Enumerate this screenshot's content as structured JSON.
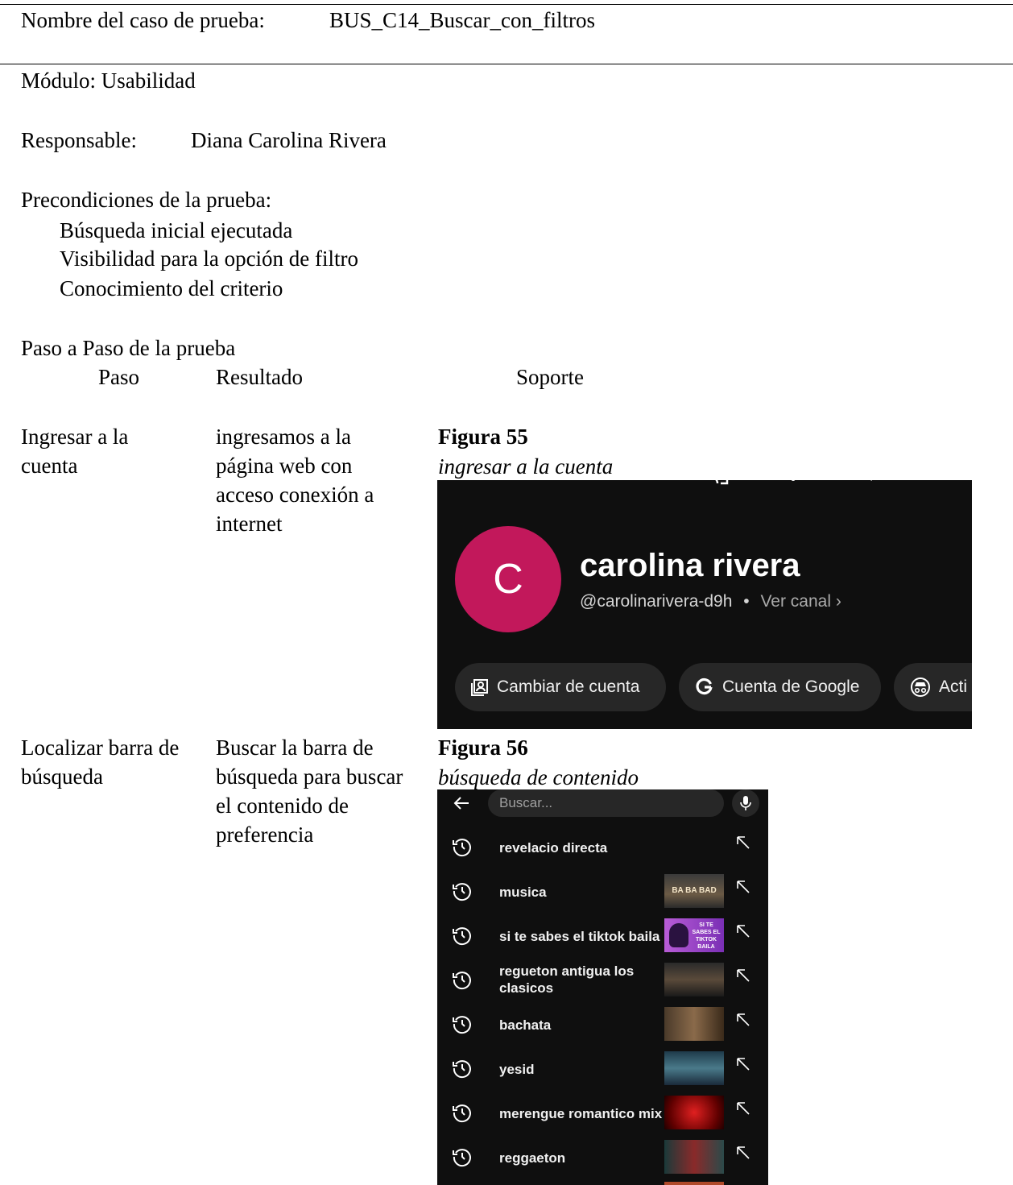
{
  "test_case": {
    "name_label": "Nombre del caso de prueba:",
    "name_value": "BUS_C14_Buscar_con_filtros",
    "module": "Módulo: Usabilidad",
    "responsible_label": "Responsable:",
    "responsible_value": "Diana Carolina Rivera",
    "preconditions_title": "Precondiciones de la prueba:",
    "preconditions": [
      "Búsqueda inicial ejecutada",
      "Visibilidad para la opción de filtro",
      "Conocimiento del criterio"
    ],
    "steps_title": "Paso a Paso de la prueba",
    "columns": [
      "Paso",
      "Resultado",
      "Soporte"
    ]
  },
  "steps": [
    {
      "step": "Ingresar a la cuenta",
      "result": "ingresamos a la página web con acceso conexión a internet",
      "figure_label": "Figura 55",
      "figure_caption": "ingresar a la cuenta"
    },
    {
      "step": "Localizar barra de búsqueda",
      "result": "Buscar la barra de búsqueda para buscar el contenido de preferencia",
      "figure_label": "Figura 56",
      "figure_caption": "búsqueda de contenido"
    }
  ],
  "account_screen": {
    "avatar_letter": "C",
    "name": "carolina rivera",
    "handle": "@carolinarivera-d9h",
    "separator": "•",
    "view_channel": "Ver canal",
    "chips": [
      "Cambiar de cuenta",
      "Cuenta de Google",
      "Acti"
    ],
    "colors": {
      "background": "#0f0f0f",
      "avatar": "#c2185b",
      "chip": "#272727"
    }
  },
  "search_screen": {
    "placeholder": "Buscar...",
    "suggestions": [
      "revelacio directa",
      "musica",
      "si te sabes el tiktok baila",
      "regueton antigua los clasicos",
      "bachata",
      "yesid",
      "merengue romantico mix",
      "reggaeton"
    ],
    "thumbnail_text": {
      "musica": "BA BA BAD",
      "tiktok": "SI TE SABES EL TIKTOK BAILA"
    }
  }
}
